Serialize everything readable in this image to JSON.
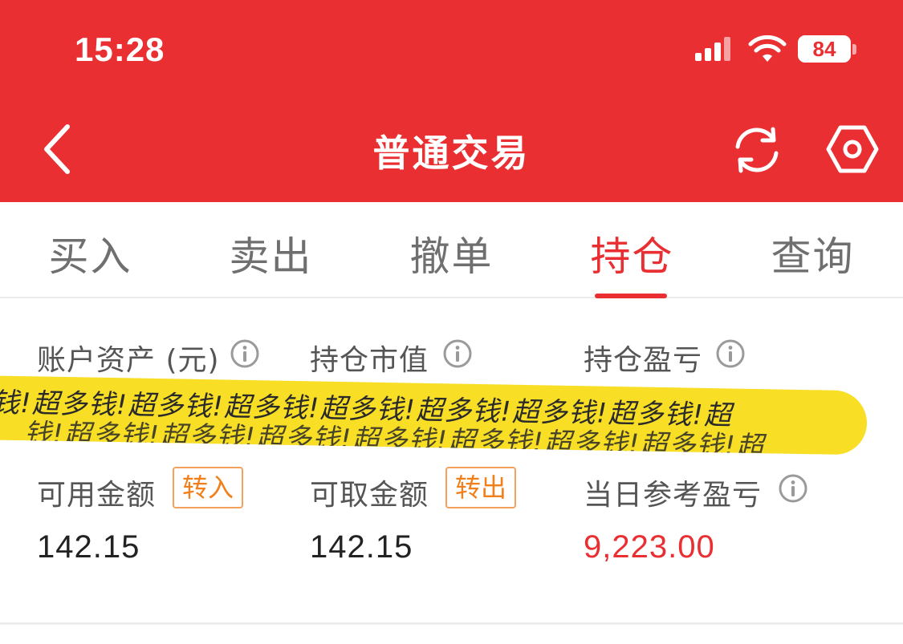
{
  "status_bar": {
    "time": "15:28",
    "battery": "84",
    "icons": [
      "signal-icon",
      "wifi-icon",
      "battery-icon"
    ]
  },
  "nav": {
    "title": "普通交易",
    "icons": [
      "back-icon",
      "refresh-icon",
      "settings-icon"
    ]
  },
  "tabs": [
    {
      "label": "买入"
    },
    {
      "label": "卖出"
    },
    {
      "label": "撤单"
    },
    {
      "label": "持仓",
      "active": true
    },
    {
      "label": "查询"
    }
  ],
  "summary": {
    "account_assets_label": "账户资产 (元)",
    "position_value_label": "持仓市值",
    "position_pnl_label": "持仓盈亏",
    "redacted_overlay_text": "钱!超多钱!超多钱!超多钱!超多钱!超多钱!超多钱!超多钱!超"
  },
  "funds": {
    "available_label": "可用金额",
    "transfer_in_label": "转入",
    "available_value": "142.15",
    "withdrawable_label": "可取金额",
    "transfer_out_label": "转出",
    "withdrawable_value": "142.15",
    "daily_pnl_label": "当日参考盈亏",
    "daily_pnl_value": "9,223.00"
  },
  "colors": {
    "brand_red": "#ea2f32",
    "badge_orange": "#f17f1a",
    "highlight_yellow": "#f8de25"
  }
}
